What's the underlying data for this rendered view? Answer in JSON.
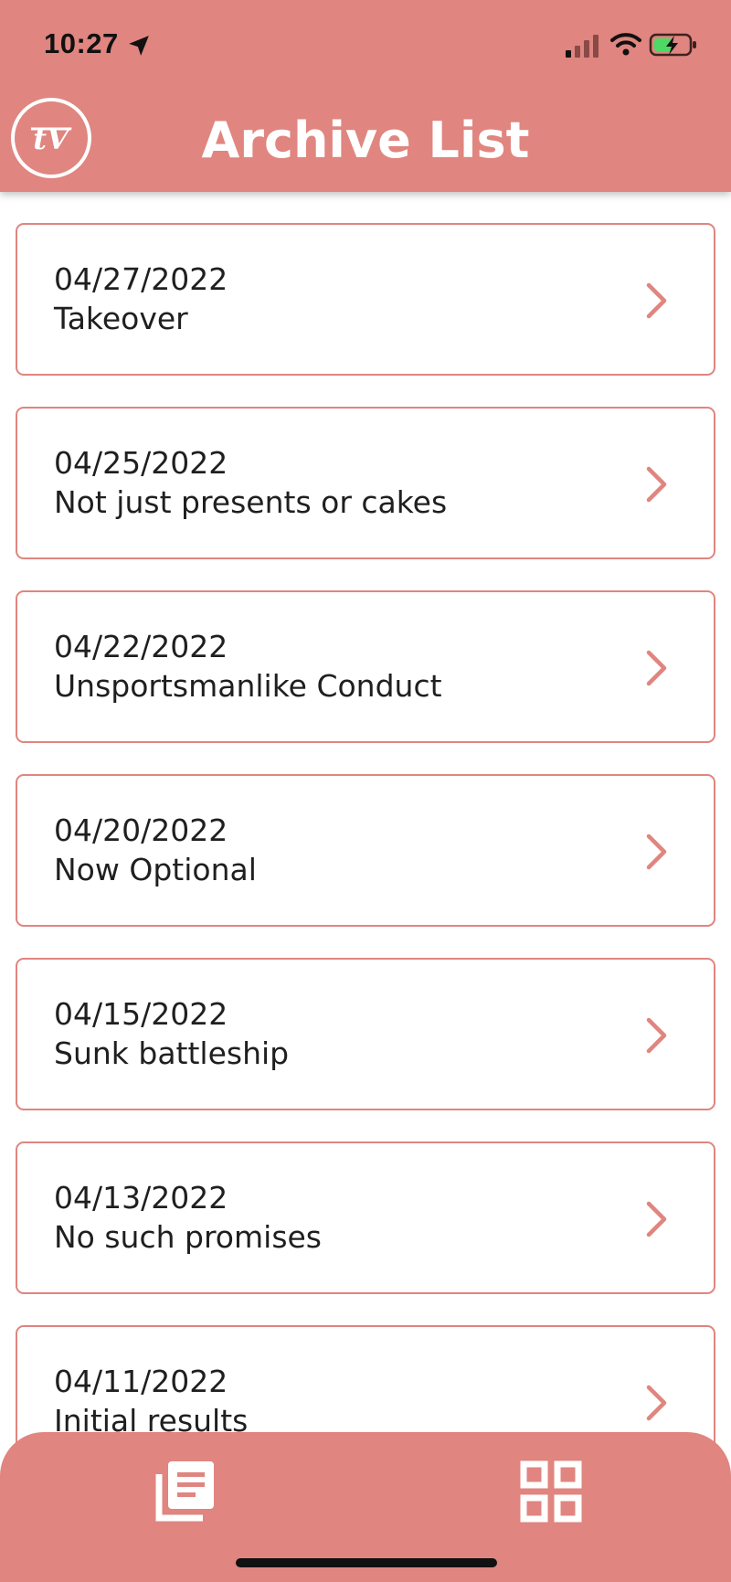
{
  "status_bar": {
    "time": "10:27"
  },
  "header": {
    "title": "Archive List"
  },
  "archive_items": [
    {
      "date": "04/27/2022",
      "title": "Takeover"
    },
    {
      "date": "04/25/2022",
      "title": "Not just presents or cakes"
    },
    {
      "date": "04/22/2022",
      "title": "Unsportsmanlike Conduct"
    },
    {
      "date": "04/20/2022",
      "title": "Now Optional"
    },
    {
      "date": "04/15/2022",
      "title": "Sunk battleship"
    },
    {
      "date": "04/13/2022",
      "title": "No such promises"
    },
    {
      "date": "04/11/2022",
      "title": "Initial results"
    }
  ],
  "icons": {
    "status": [
      "location-icon",
      "signal-icon",
      "wifi-icon",
      "battery-charging-icon"
    ],
    "logo": "tv-logo-icon",
    "row_action": "chevron-right-icon",
    "tabs": [
      "archive-list-icon",
      "grid-icon"
    ]
  },
  "colors": {
    "accent": "#e0857f",
    "background": "#ffffff",
    "text": "#1f1f1f",
    "battery_fill": "#4cd964"
  }
}
